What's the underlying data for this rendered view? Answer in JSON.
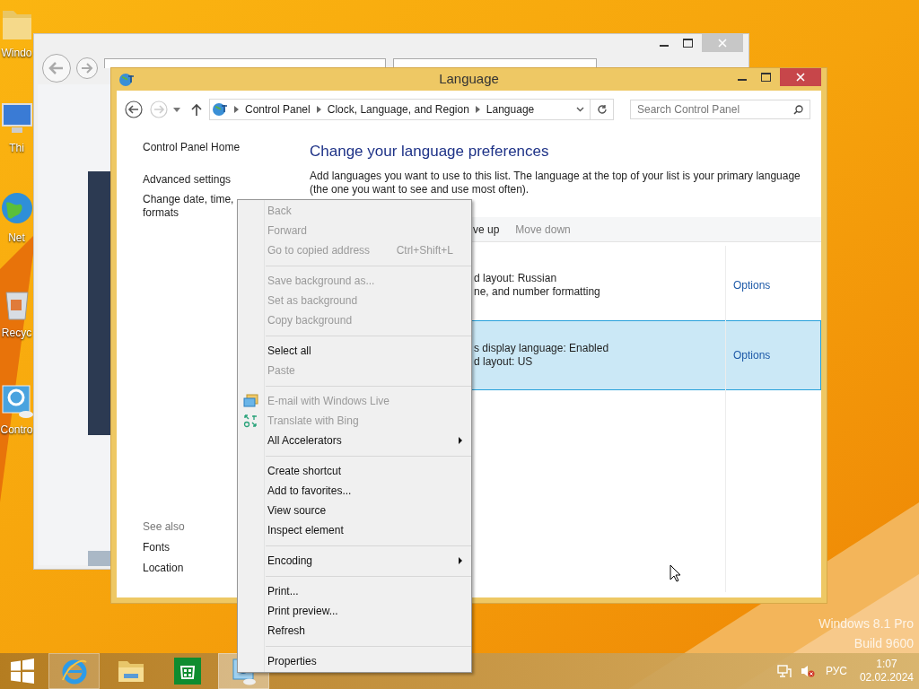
{
  "desktop": {
    "icons": [
      {
        "kind": "folder",
        "label": "Windo"
      },
      {
        "kind": "computer",
        "label": "Thi"
      },
      {
        "kind": "globe",
        "label": "Net"
      },
      {
        "kind": "bin",
        "label": "Recyc"
      },
      {
        "kind": "panel",
        "label": "Contro"
      }
    ],
    "watermark": [
      "Windows 8.1 Pro",
      "Build 9600"
    ]
  },
  "language_window": {
    "title": "Language",
    "breadcrumb": [
      "Control Panel",
      "Clock, Language, and Region",
      "Language"
    ],
    "search": {
      "placeholder": "Search Control Panel"
    },
    "sidebar": {
      "links": [
        "Control Panel Home",
        "Advanced settings"
      ],
      "wrapped_link": [
        "Change date, time,",
        "formats"
      ],
      "see_also_heading": "See also",
      "see_also": [
        "Fonts",
        "Location"
      ]
    },
    "heading": "Change your language preferences",
    "description": "Add languages you want to use to this list. The language at the top of your list is your primary language (the one you want to see and use most often).",
    "toolbar": [
      {
        "label": "ve up",
        "disabled": false
      },
      {
        "label": "Move down",
        "disabled": true
      }
    ],
    "languages": [
      {
        "lines": [
          "d layout: Russian",
          "ne, and number formatting"
        ],
        "options": "Options",
        "selected": false
      },
      {
        "lines": [
          "s display language: Enabled",
          "d layout: US"
        ],
        "options": "Options",
        "selected": true
      }
    ]
  },
  "context_menu": {
    "groups": [
      [
        {
          "label": "Back",
          "disabled": true
        },
        {
          "label": "Forward",
          "disabled": true
        },
        {
          "label": "Go to copied address",
          "shortcut": "Ctrl+Shift+L",
          "disabled": true
        }
      ],
      [
        {
          "label": "Save background as...",
          "disabled": true
        },
        {
          "label": "Set as background",
          "disabled": true
        },
        {
          "label": "Copy background",
          "disabled": true
        }
      ],
      [
        {
          "label": "Select all",
          "disabled": false
        },
        {
          "label": "Paste",
          "disabled": true
        }
      ],
      [
        {
          "label": "E-mail with Windows Live",
          "disabled": true,
          "kind": "mail"
        },
        {
          "label": "Translate with Bing",
          "disabled": true,
          "kind": "translate"
        },
        {
          "label": "All Accelerators",
          "disabled": false,
          "submenu": true
        }
      ],
      [
        {
          "label": "Create shortcut",
          "disabled": false
        },
        {
          "label": "Add to favorites...",
          "disabled": false
        },
        {
          "label": "View source",
          "disabled": false
        },
        {
          "label": "Inspect element",
          "disabled": false
        }
      ],
      [
        {
          "label": "Encoding",
          "disabled": false,
          "submenu": true
        }
      ],
      [
        {
          "label": "Print...",
          "disabled": false
        },
        {
          "label": "Print preview...",
          "disabled": false
        },
        {
          "label": "Refresh",
          "disabled": false
        }
      ],
      [
        {
          "label": "Properties",
          "disabled": false
        }
      ]
    ]
  },
  "taskbar": {
    "apps": [
      {
        "kind": "ie",
        "running": true,
        "active": false
      },
      {
        "kind": "explorer",
        "running": false,
        "active": false
      },
      {
        "kind": "store",
        "running": false,
        "active": false
      },
      {
        "kind": "control_panel",
        "running": true,
        "active": true
      }
    ],
    "tray": {
      "language": "РУС",
      "time": "1:07",
      "date": "02.02.2024"
    }
  }
}
